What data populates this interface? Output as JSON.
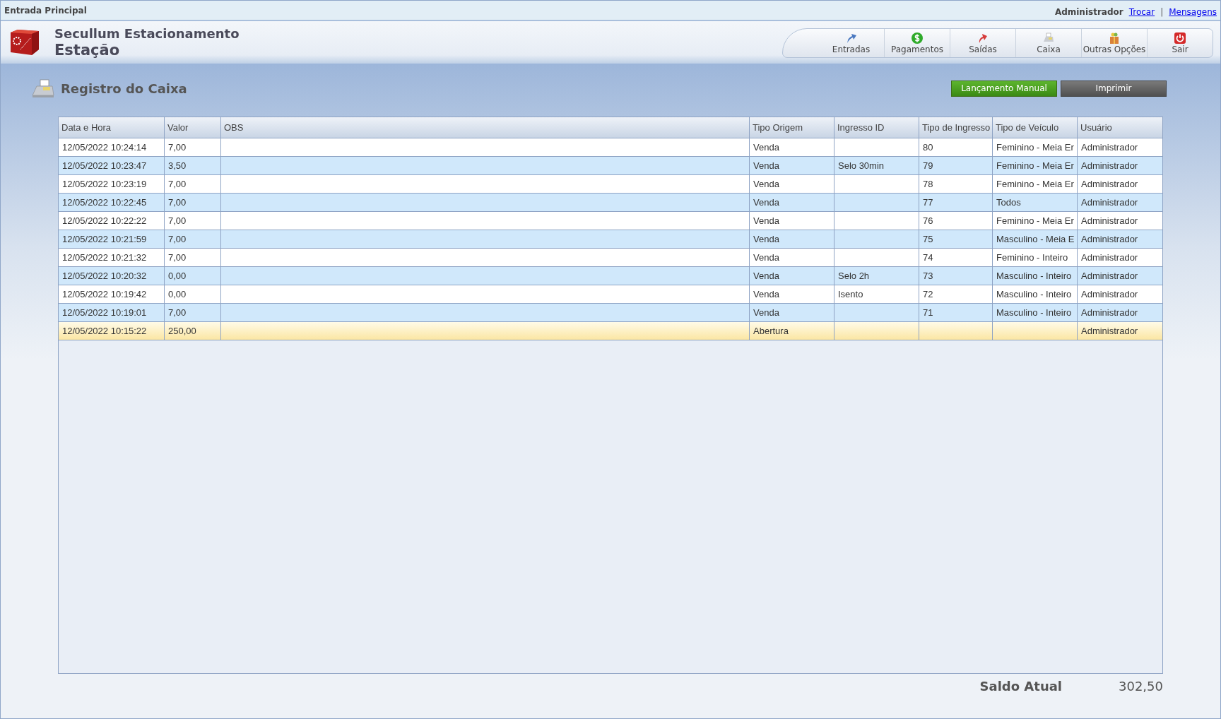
{
  "top_bar": {
    "title": "Entrada Principal",
    "user": "Administrador",
    "links": [
      "Trocar",
      "Mensagens"
    ],
    "separator": "|"
  },
  "header": {
    "app_name": "Secullum Estacionamento",
    "subtitle": "Estação"
  },
  "nav": [
    {
      "label": "Entradas",
      "kind": "entradas"
    },
    {
      "label": "Pagamentos",
      "kind": "pagamentos"
    },
    {
      "label": "Saídas",
      "kind": "saidas"
    },
    {
      "label": "Caixa",
      "kind": "caixa"
    },
    {
      "label": "Outras Opções",
      "kind": "outras"
    },
    {
      "label": "Sair",
      "kind": "sair"
    }
  ],
  "page": {
    "title": "Registro do Caixa",
    "buttons": [
      {
        "label": "Lançamento Manual",
        "kind": "primary"
      },
      {
        "label": "Imprimir",
        "kind": "secondary"
      }
    ]
  },
  "table": {
    "columns": [
      "Data e Hora",
      "Valor",
      "OBS",
      "Tipo Origem",
      "Ingresso ID",
      "Tipo de Ingresso",
      "Tipo de Veículo",
      "Usuário"
    ],
    "rows": [
      {
        "selected": false,
        "cells": [
          "12/05/2022 10:24:14",
          "7,00",
          "",
          "Venda",
          "",
          "80",
          "Feminino - Meia Er",
          "Administrador"
        ]
      },
      {
        "selected": false,
        "cells": [
          "12/05/2022 10:23:47",
          "3,50",
          "",
          "Venda",
          "Selo 30min",
          "79",
          "Feminino - Meia Er",
          "Administrador"
        ]
      },
      {
        "selected": false,
        "cells": [
          "12/05/2022 10:23:19",
          "7,00",
          "",
          "Venda",
          "",
          "78",
          "Feminino - Meia Er",
          "Administrador"
        ]
      },
      {
        "selected": false,
        "cells": [
          "12/05/2022 10:22:45",
          "7,00",
          "",
          "Venda",
          "",
          "77",
          "Todos",
          "Administrador"
        ]
      },
      {
        "selected": false,
        "cells": [
          "12/05/2022 10:22:22",
          "7,00",
          "",
          "Venda",
          "",
          "76",
          "Feminino - Meia Er",
          "Administrador"
        ]
      },
      {
        "selected": false,
        "cells": [
          "12/05/2022 10:21:59",
          "7,00",
          "",
          "Venda",
          "",
          "75",
          "Masculino - Meia E",
          "Administrador"
        ]
      },
      {
        "selected": false,
        "cells": [
          "12/05/2022 10:21:32",
          "7,00",
          "",
          "Venda",
          "",
          "74",
          "Feminino - Inteiro",
          "Administrador"
        ]
      },
      {
        "selected": false,
        "cells": [
          "12/05/2022 10:20:32",
          "0,00",
          "",
          "Venda",
          "Selo 2h",
          "73",
          "Masculino - Inteiro",
          "Administrador"
        ]
      },
      {
        "selected": false,
        "cells": [
          "12/05/2022 10:19:42",
          "0,00",
          "",
          "Venda",
          "Isento",
          "72",
          "Masculino - Inteiro",
          "Administrador"
        ]
      },
      {
        "selected": false,
        "cells": [
          "12/05/2022 10:19:01",
          "7,00",
          "",
          "Venda",
          "",
          "71",
          "Masculino - Inteiro",
          "Administrador"
        ]
      },
      {
        "selected": true,
        "cells": [
          "12/05/2022 10:15:22",
          "250,00",
          "",
          "Abertura",
          "",
          "",
          "",
          "Administrador"
        ]
      }
    ]
  },
  "balance": {
    "label": "Saldo Atual",
    "value": "302,50"
  }
}
